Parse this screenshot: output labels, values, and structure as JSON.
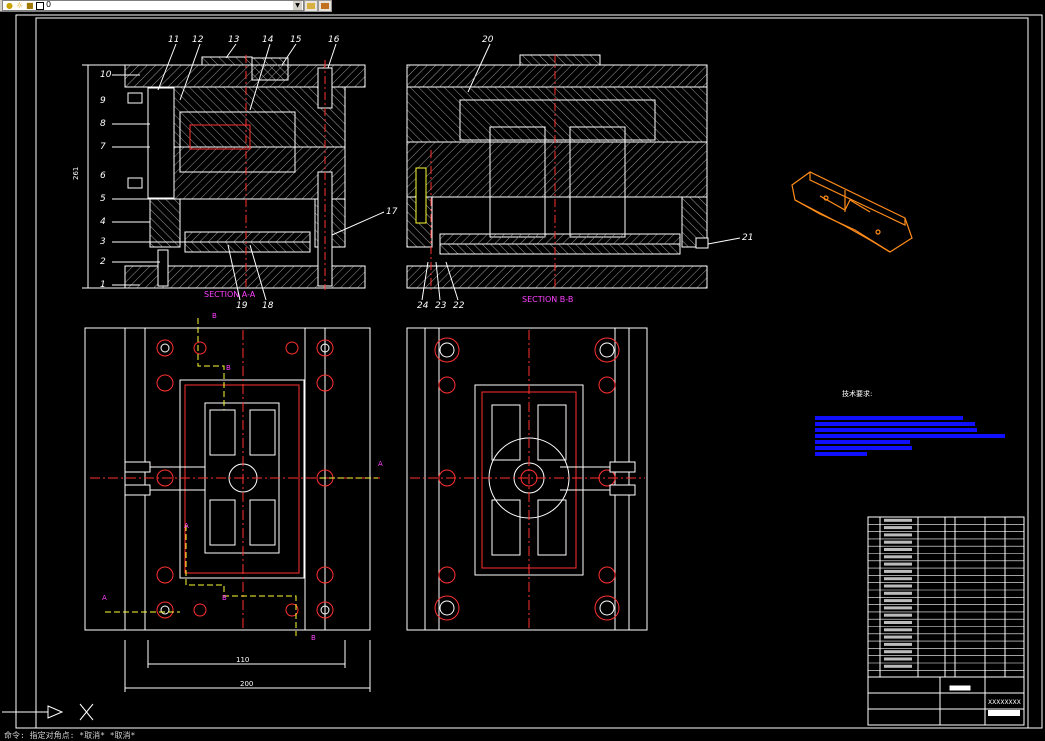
{
  "toolbar": {
    "layer_value": "0"
  },
  "drawing": {
    "section_a_label": "SECTION A-A",
    "section_b_label": "SECTION B-B",
    "callouts_top": [
      "11",
      "12",
      "13",
      "14",
      "15",
      "16",
      "20"
    ],
    "callouts_left": [
      "10",
      "9",
      "8",
      "7",
      "6",
      "5",
      "4",
      "3",
      "2",
      "1"
    ],
    "callouts_bottom_a": [
      "19",
      "18"
    ],
    "callouts_bottom_b": [
      "24",
      "23",
      "22"
    ],
    "callout_right_17": "17",
    "callout_right_21": "21",
    "dim_width_inner": "110",
    "dim_width_outer": "200",
    "tech_requirements_title": "技术要求:",
    "section_marks": {
      "A": "A",
      "B": "B"
    }
  },
  "title_block": {
    "drawing_number": "XXXXXXXX"
  },
  "colors": {
    "background": "#000000",
    "line_white": "#ffffff",
    "hatch": "#bfbfbf",
    "red_center": "#ff3030",
    "magenta_text": "#ff40ff",
    "yellow_mark": "#ffff33",
    "blue_block": "#1010ff",
    "orange_part": "#ff8c1a"
  },
  "icons": [
    "ucs-icon",
    "layer-lightbulb-icon",
    "layer-sun-icon",
    "layer-lock-icon",
    "layer-color-icon"
  ],
  "command_line": {
    "text": "命令: 指定对角点: *取消*          *取消*"
  }
}
